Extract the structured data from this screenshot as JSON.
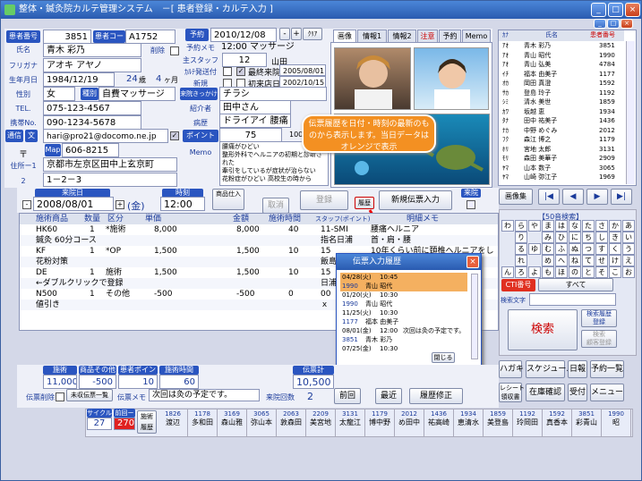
{
  "window": {
    "title": "整体・鍼灸院カルテ管理システム　－[ 患者登録・カルテ入力 ]",
    "btn_min": "_",
    "btn_max": "□",
    "btn_close": "×",
    "btn_min2": "_",
    "btn_max2": "□",
    "btn_close2": "×"
  },
  "patient": {
    "id_label": "患者番号",
    "id": "3851",
    "code_label": "患者コード",
    "code": "A1752",
    "name_label": "氏名",
    "name": "青木 彩乃",
    "delete_label": "削除",
    "kana_label": "フリガナ",
    "kana": "アオキ アヤノ",
    "birth_label": "生年月日",
    "birth": "1984/12/19",
    "age": "24",
    "age_unit": "歳",
    "months": "4",
    "months_unit": "ヶ月",
    "sex_label": "性別",
    "sex": "女",
    "kind_label": "種別",
    "kind": "自費マッサージ",
    "tel_label": "TEL.",
    "tel": "075-123-4567",
    "mobile_label": "携帯No.",
    "mobile": "090-1234-5678",
    "mail_btn": "通信",
    "mail_btn2": "文",
    "mail": "hari@pro21@docomo.ne.jp",
    "zip_label": "〒",
    "zip_btn": "Map",
    "zip": "606-8215",
    "addr1_label": "住所ー1",
    "addr1": "京都市左京区田中上玄京町",
    "addr2_label": "2",
    "addr2": "1－2－3"
  },
  "appointment": {
    "label": "予約",
    "date": "2010/12/08",
    "minus": "-",
    "plus": "+",
    "clear": "ｸﾘｱ",
    "memo_label": "予約メモ",
    "memo": "12:00 マッサージ",
    "staff_label": "主スタッフ",
    "staff_no": "12",
    "staff": "山田",
    "card_label": "ｶﾙﾃ発送付",
    "last_visit_label": "最終来院",
    "last_visit": "2005/08/01",
    "new_label": "新規",
    "first_visit_label": "初来店日",
    "first_visit": "2002/10/15",
    "trigger_btn": "来院きっかけ",
    "trigger": "チラシ",
    "intro_label": "紹介者",
    "intro": "田中さん",
    "condition_label": "病歴",
    "condition": "ドライアイ 腰痛",
    "points_label": "ポイント",
    "points": "75",
    "points_max": "1000",
    "memo2_label": "Memo",
    "memo2_lines": [
      "腰痛がひどい",
      "整形外科でヘルニアの初期と診断さ",
      "れた",
      "牽引をしているが症状が治らない",
      "花粉症がひどい 高校生の時から"
    ]
  },
  "tabs": [
    "画像",
    "情報1",
    "情報2",
    "注意",
    "予約",
    "Memo"
  ],
  "callout": "伝票履歴を日付・時刻の最新のものから表示します。当日データはオレンジで表示",
  "visit": {
    "date_label": "来院日",
    "date": "2008/08/01",
    "weekday": "(金)",
    "time_label": "時刻",
    "time": "12:00",
    "product_label": "商品仕入",
    "cancel": "取消",
    "register": "登録",
    "history": "履歴",
    "new_slip": "新規伝票入力",
    "visit_label": "来院"
  },
  "grid": {
    "headers": [
      "施術商品",
      "数量",
      "区分",
      "単価",
      "金額",
      "施術時間",
      "スタッフ(ポイント)",
      "明細メモ"
    ],
    "rows": [
      {
        "code": "HK60",
        "qty": "1",
        "kind": "*施術",
        "price": "8,000",
        "amount": "8,000",
        "time": "40",
        "staff": "11-SMI",
        "memo": "腰痛ヘルニア"
      },
      {
        "code": "鍼灸 60分コース",
        "qty": "",
        "kind": "",
        "price": "",
        "amount": "",
        "time": "",
        "staff": "指名日浦",
        "memo": "首・肩・腰"
      },
      {
        "code": "KF",
        "qty": "1",
        "kind": "*OP",
        "price": "1,500",
        "amount": "1,500",
        "time": "10",
        "staff": "15",
        "memo": "10年くらい前に頚椎ヘルニアをし"
      },
      {
        "code": "花粉対策",
        "qty": "",
        "kind": "",
        "price": "",
        "amount": "",
        "time": "",
        "staff": "飯島",
        "memo": ""
      },
      {
        "code": "DE",
        "qty": "1",
        "kind": "施術",
        "price": "1,500",
        "amount": "1,500",
        "time": "10",
        "staff": "15",
        "memo": ""
      },
      {
        "code": "←ダブルクリックで登録",
        "qty": "",
        "kind": "",
        "price": "",
        "amount": "",
        "time": "",
        "staff": "日浦",
        "memo": ""
      },
      {
        "code": "N500",
        "qty": "1",
        "kind": "その他",
        "price": "-500",
        "amount": "-500",
        "time": "0",
        "staff": "00",
        "memo": ""
      },
      {
        "code": "値引き",
        "qty": "",
        "kind": "",
        "price": "",
        "amount": "",
        "time": "",
        "staff": "ｘ",
        "memo": ""
      }
    ]
  },
  "totals": {
    "treat_label": "施術",
    "treat": "11,000",
    "prod_label": "商品その他",
    "prod": "-500",
    "pts_label": "患者ポイント",
    "pts": "10",
    "time_label": "施術時間",
    "time": "60",
    "slip_label": "伝票計",
    "slip": "10,500",
    "slip_del": "伝票削除",
    "unrec_btn": "未収伝票一覧",
    "memo_label": "伝票メモ",
    "memo": "次回は灸の予定です。",
    "count_label": "来院回数",
    "count": "2",
    "prev": "前回",
    "latest": "最近",
    "fix": "履歴修正"
  },
  "popup": {
    "title": "伝票入力履歴",
    "rows": [
      {
        "date": "04/28(火)",
        "time": "10:45",
        "id": "",
        "name": ""
      },
      {
        "date": "",
        "time": "",
        "id": "1990",
        "name": "青山 昭代"
      },
      {
        "date": "01/20(火)",
        "time": "10:30",
        "id": "",
        "name": ""
      },
      {
        "date": "",
        "time": "",
        "id": "1990",
        "name": "青山 昭代"
      },
      {
        "date": "11/25(火)",
        "time": "10:30",
        "id": "",
        "name": ""
      },
      {
        "date": "",
        "time": "",
        "id": "1177",
        "name": "福本 由美子"
      },
      {
        "date": "08/01(金)",
        "time": "12:00",
        "id": "",
        "name": "次回は灸の予定です。"
      },
      {
        "date": "",
        "time": "",
        "id": "3851",
        "name": "青木 彩乃"
      },
      {
        "date": "07/25(金)",
        "time": "10:30",
        "id": "",
        "name": ""
      }
    ],
    "close_btn": "閉じる"
  },
  "customers": {
    "headers": [
      "ｶﾅ",
      "氏名",
      "患者番号"
    ],
    "rows": [
      [
        "ｱｵ",
        "青木 彩乃",
        "3851"
      ],
      [
        "ｱｵ",
        "青山 昭代",
        "1990"
      ],
      [
        "ｱｵ",
        "青山 弘美",
        "4784"
      ],
      [
        "ｲﾁ",
        "福本 由美子",
        "1177"
      ],
      [
        "ｵｶ",
        "岡田 真澄",
        "1592"
      ],
      [
        "ｻｶ",
        "登島 玲子",
        "1192"
      ],
      [
        "ｼﾐ",
        "清水 美世",
        "1859"
      ],
      [
        "ｶﾜ",
        "坂越 恵",
        "1934"
      ],
      [
        "ﾀﾅ",
        "田中 祐美子",
        "1436"
      ],
      [
        "ﾅｶ",
        "中野 めぐみ",
        "2012"
      ],
      [
        "ﾌｸ",
        "森江 博之",
        "1179"
      ],
      [
        "ﾎﾘ",
        "宮地 太郎",
        "3131"
      ],
      [
        "ﾓﾘ",
        "森田 美華子",
        "2909"
      ],
      [
        "ﾔﾏ",
        "山本 数子",
        "3065"
      ],
      [
        "ﾔﾏ",
        "山崎 弥江子",
        "1969"
      ]
    ]
  },
  "right": {
    "image_btn": "画像集",
    "kana_title": "【50音検索】",
    "kana": [
      "わ",
      "ら",
      "や",
      "ま",
      "は",
      "な",
      "た",
      "さ",
      "か",
      "あ",
      "",
      "り",
      "",
      "み",
      "ひ",
      "に",
      "ち",
      "し",
      "き",
      "い",
      "",
      "る",
      "ゆ",
      "む",
      "ふ",
      "ぬ",
      "つ",
      "す",
      "く",
      "う",
      "",
      "れ",
      "",
      "め",
      "へ",
      "ね",
      "て",
      "せ",
      "け",
      "え",
      "ん",
      "ろ",
      "よ",
      "も",
      "ほ",
      "の",
      "と",
      "そ",
      "こ",
      "お"
    ],
    "cti": "CTI番号",
    "all": "すべて",
    "search_label": "検索文字",
    "search": "検索",
    "hist_search": "検索履歴\n登録",
    "cust_reg": "検索\n顧客登録",
    "postcard": "ハガキ",
    "schedule": "スケジュール",
    "daily": "日報",
    "reserve": "予約一覧",
    "receipt": "レシート\n領収書",
    "stock": "在庫確認",
    "reception": "受付",
    "menu": "メニュー"
  },
  "history_bar": {
    "cycle_label": "サイクル",
    "cycle": "27",
    "count_label": "前回ー",
    "count": "270",
    "title": "施術\n履歴",
    "items": [
      {
        "id": "1826",
        "name": "渡辺"
      },
      {
        "id": "1178",
        "name": "多和田"
      },
      {
        "id": "3169",
        "name": "森山雅"
      },
      {
        "id": "3065",
        "name": "弥山本"
      },
      {
        "id": "2063",
        "name": "敦森田"
      },
      {
        "id": "2209",
        "name": "美宮地"
      },
      {
        "id": "3131",
        "name": "太龍江"
      },
      {
        "id": "1179",
        "name": "博中野"
      },
      {
        "id": "2012",
        "name": "め田中"
      },
      {
        "id": "1436",
        "name": "祐高崎"
      },
      {
        "id": "1934",
        "name": "恵清水"
      },
      {
        "id": "1859",
        "name": "美登島"
      },
      {
        "id": "1192",
        "name": "玲岡田"
      },
      {
        "id": "1592",
        "name": "真香本"
      },
      {
        "id": "3851",
        "name": "彩青山"
      },
      {
        "id": "1990",
        "name": "昭"
      }
    ]
  }
}
